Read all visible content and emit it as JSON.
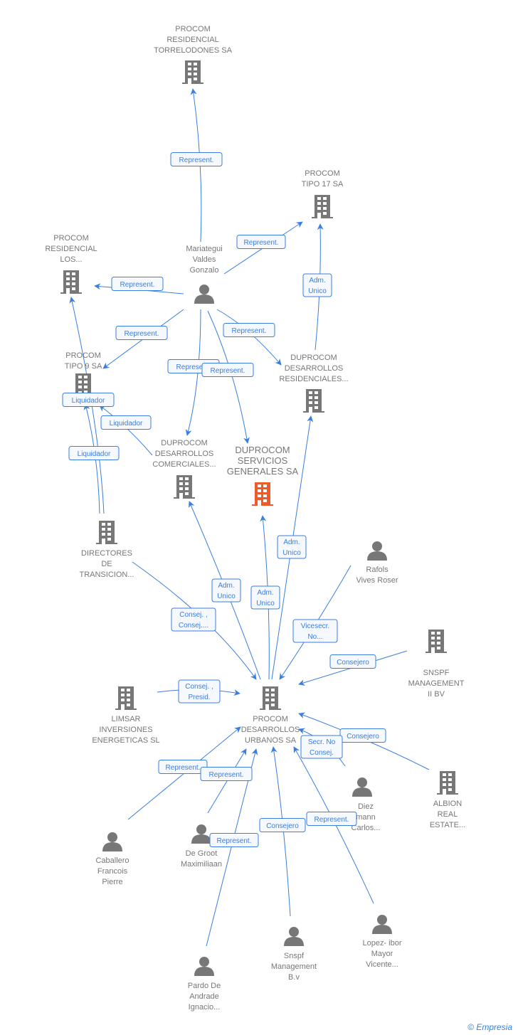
{
  "colors": {
    "edge": "#3a7ee0",
    "node": "#777777",
    "focus": "#f05a28"
  },
  "nodes": [
    {
      "type": "company",
      "label": [
        "PROCOM",
        "RESIDENCIAL",
        "TORRELODONES SA"
      ]
    },
    {
      "type": "company",
      "label": [
        "PROCOM",
        "TIPO 17 SA"
      ]
    },
    {
      "type": "company",
      "label": [
        "PROCOM",
        "RESIDENCIAL",
        "LOS..."
      ]
    },
    {
      "type": "person",
      "label": [
        "Mariategui",
        "Valdes",
        "Gonzalo"
      ]
    },
    {
      "type": "company",
      "label": [
        "PROCOM",
        "TIPO 9 SA"
      ]
    },
    {
      "type": "company",
      "label": [
        "DUPROCOM",
        "DESARROLLOS",
        "RESIDENCIALES..."
      ]
    },
    {
      "type": "company",
      "label": [
        "DUPROCOM",
        "DESARROLLOS",
        "COMERCIALES..."
      ]
    },
    {
      "type": "company",
      "focus": true,
      "label": [
        "DUPROCOM",
        "SERVICIOS",
        "GENERALES SA"
      ]
    },
    {
      "type": "company",
      "label": [
        "DIRECTORES",
        "DE",
        "TRANSICION..."
      ]
    },
    {
      "type": "person",
      "label": [
        "Rafols",
        "Vives Roser"
      ]
    },
    {
      "type": "company",
      "label": [
        "SNSPF",
        "MANAGEMENT",
        "II BV"
      ]
    },
    {
      "type": "company",
      "label": [
        "LIMSAR",
        "INVERSIONES",
        "ENERGETICAS SL"
      ]
    },
    {
      "type": "company",
      "label": [
        "PROCOM",
        "DESARROLLOS",
        "URBANOS SA"
      ]
    },
    {
      "type": "company",
      "label": [
        "ALBION",
        "REAL",
        "ESTATE..."
      ]
    },
    {
      "type": "person",
      "label": [
        "Diez",
        "mann",
        "Carlos..."
      ]
    },
    {
      "type": "person",
      "label": [
        "Caballero",
        "Francois",
        "Pierre"
      ]
    },
    {
      "type": "person",
      "label": [
        "De Groot",
        "Maximiliaan"
      ]
    },
    {
      "type": "person",
      "label": [
        "Snspf",
        "Management",
        "B.v"
      ]
    },
    {
      "type": "person",
      "label": [
        "Lopez- ibor",
        "Mayor",
        "Vicente..."
      ]
    },
    {
      "type": "person",
      "label": [
        "Pardo De",
        "Andrade",
        "Ignacio..."
      ]
    }
  ],
  "edges": [
    [
      "Represent."
    ],
    [
      "Represent."
    ],
    [
      "Adm.",
      "Unico"
    ],
    [
      "Represent."
    ],
    [
      "Represent."
    ],
    [
      "Represent."
    ],
    [
      "Represent."
    ],
    [
      "Represent."
    ],
    [
      "Liquidador"
    ],
    [
      "Liquidador"
    ],
    [
      "Liquidador"
    ],
    [
      "Adm.",
      "Unico"
    ],
    [
      "Adm.",
      "Unico"
    ],
    [
      "Adm.",
      "Unico"
    ],
    [
      "Consej. ,",
      "Consej...."
    ],
    [
      "Vicesecr.",
      "No..."
    ],
    [
      "Consejero"
    ],
    [
      "Consej. ,",
      "Presid."
    ],
    [
      "Consejero"
    ],
    [
      "Secr.  No",
      "Consej."
    ],
    [
      "Represent."
    ],
    [
      "Represent."
    ],
    [
      "Represent."
    ],
    [
      "Consejero"
    ],
    [
      "Represent."
    ]
  ],
  "footer": {
    "brand": "Empresia",
    "copyright": "©"
  }
}
